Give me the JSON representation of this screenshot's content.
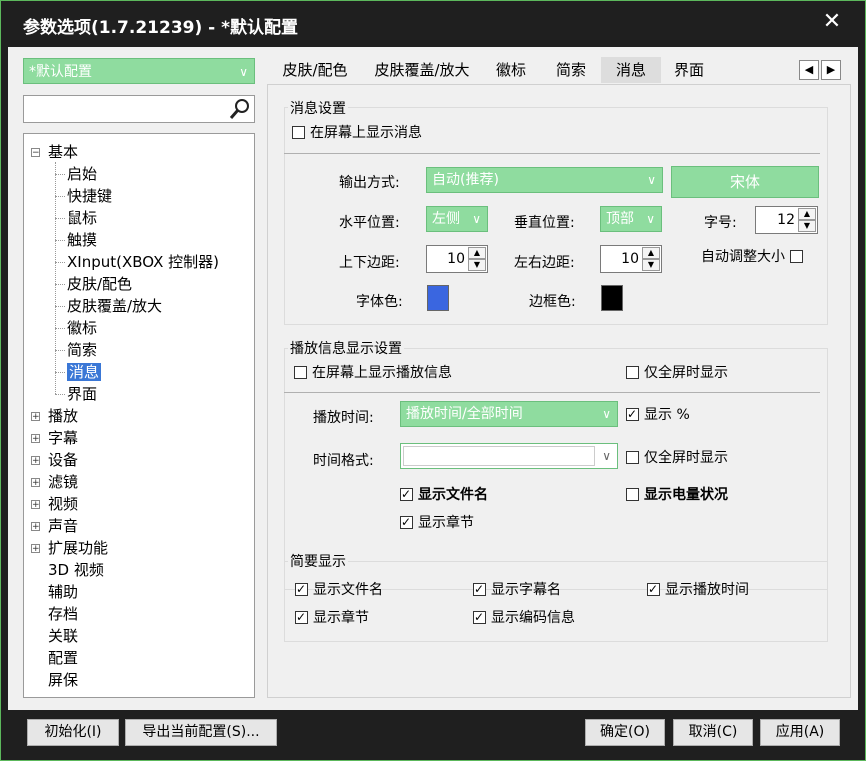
{
  "window": {
    "title": "参数选项(1.7.21239) - *默认配置",
    "close_glyph": "✕"
  },
  "profile": {
    "value": "*默认配置"
  },
  "tree": [
    {
      "label": "基本",
      "expander": "minus"
    },
    {
      "label": "启始"
    },
    {
      "label": "快捷键"
    },
    {
      "label": "鼠标"
    },
    {
      "label": "触摸"
    },
    {
      "label": "XInput(XBOX 控制器)"
    },
    {
      "label": "皮肤/配色"
    },
    {
      "label": "皮肤覆盖/放大"
    },
    {
      "label": "徽标"
    },
    {
      "label": "简索"
    },
    {
      "label": "消息",
      "selected": true
    },
    {
      "label": "界面"
    },
    {
      "label": "播放",
      "expander": "plus"
    },
    {
      "label": "字幕",
      "expander": "plus"
    },
    {
      "label": "设备",
      "expander": "plus"
    },
    {
      "label": "滤镜",
      "expander": "plus"
    },
    {
      "label": "视频",
      "expander": "plus"
    },
    {
      "label": "声音",
      "expander": "plus"
    },
    {
      "label": "扩展功能",
      "expander": "plus"
    },
    {
      "label": "3D 视频"
    },
    {
      "label": "辅助"
    },
    {
      "label": "存档"
    },
    {
      "label": "关联"
    },
    {
      "label": "配置"
    },
    {
      "label": "屏保"
    }
  ],
  "tabs": [
    "皮肤/配色",
    "皮肤覆盖/放大",
    "徽标",
    "简索",
    "消息",
    "界面"
  ],
  "tab_nav": {
    "prev": "◀",
    "next": "▶"
  },
  "msg": {
    "group_title": "消息设置",
    "show_on_screen": "在屏幕上显示消息",
    "output_label": "输出方式:",
    "output_value": "自动(推荐)",
    "font_button": "宋体",
    "hpos_label": "水平位置:",
    "hpos_value": "左侧",
    "vpos_label": "垂直位置:",
    "vpos_value": "顶部",
    "size_label": "字号:",
    "size_value": "12",
    "vmargin_label": "上下边距:",
    "vmargin_value": "10",
    "hmargin_label": "左右边距:",
    "hmargin_value": "10",
    "autosize_label": "自动调整大小",
    "fontcolor_label": "字体色:",
    "bordercolor_label": "边框色:",
    "font_color": "#3a66e0",
    "border_color": "#000000"
  },
  "play": {
    "group_title": "播放信息显示设置",
    "show_play_info": "在屏幕上显示播放信息",
    "fullscreen_only": "仅全屏时显示",
    "time_label": "播放时间:",
    "time_value": "播放时间/全部时间",
    "show_percent": "显示 %",
    "format_label": "时间格式:",
    "format_value": "",
    "fullscreen_only2": "仅全屏时显示",
    "show_filename": "显示文件名",
    "show_battery": "显示电量状况",
    "show_chapter": "显示章节"
  },
  "brief": {
    "group_title": "简要显示",
    "items": [
      "显示文件名",
      "显示字幕名",
      "显示播放时间",
      "显示章节",
      "显示编码信息"
    ]
  },
  "footer": {
    "init": "初始化(I)",
    "export": "导出当前配置(S)...",
    "ok": "确定(O)",
    "cancel": "取消(C)",
    "apply": "应用(A)"
  },
  "colors": {
    "accent_green": "#8fdc9f",
    "window_border": "#5cb85c",
    "selection": "#3a77d6"
  }
}
